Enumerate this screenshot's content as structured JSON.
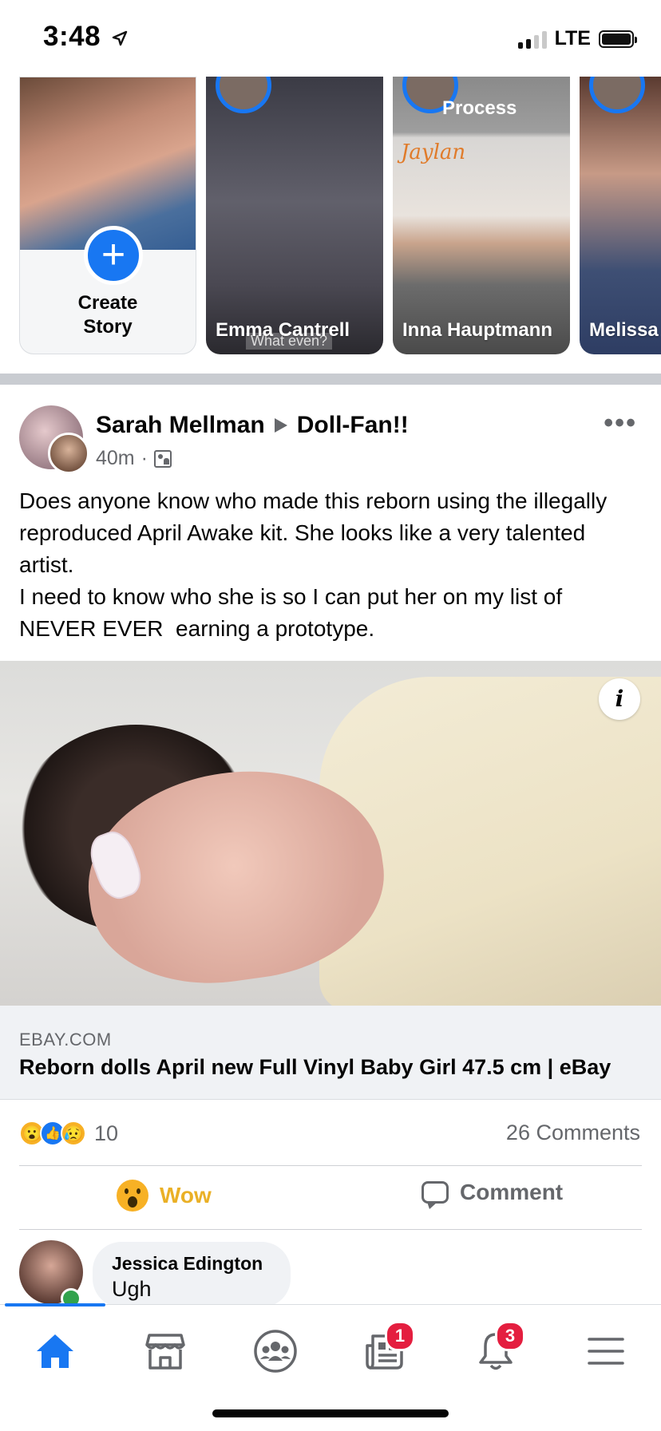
{
  "status_bar": {
    "time": "3:48",
    "network": "LTE"
  },
  "stories": {
    "create_label": "Create\nStory",
    "items": [
      {
        "name": "Emma Cantrell",
        "caption": "What even?"
      },
      {
        "name": "Inna Hauptmann",
        "overlay": "Process",
        "brand": "Jaylan"
      },
      {
        "name": "Melissa"
      }
    ]
  },
  "post": {
    "author": "Sarah Mellman",
    "group": "Doll-Fan!!",
    "time": "40m",
    "separator": "·",
    "more": "•••",
    "text": "Does anyone know who made this reborn using the illegally reproduced April Awake kit. She looks like a very talented artist.\nI need to know who she is so I can put her on my list of NEVER EVER  earning a prototype.",
    "link": {
      "domain": "EBAY.COM",
      "title": "Reborn dolls April new Full Vinyl Baby Girl 47.5 cm | eBay",
      "info": "i"
    },
    "reaction_count": "10",
    "comments_count": "26 Comments",
    "actions": {
      "wow": "Wow",
      "comment": "Comment"
    },
    "comment": {
      "name": "Jessica Edington",
      "text": "Ugh"
    }
  },
  "tabbar": {
    "active": "home",
    "badges": {
      "news": "1",
      "notifications": "3"
    }
  },
  "colors": {
    "accent": "#1877f2",
    "wow": "#f7b125",
    "badge": "#e41e3f",
    "secondary_text": "#65676b"
  }
}
